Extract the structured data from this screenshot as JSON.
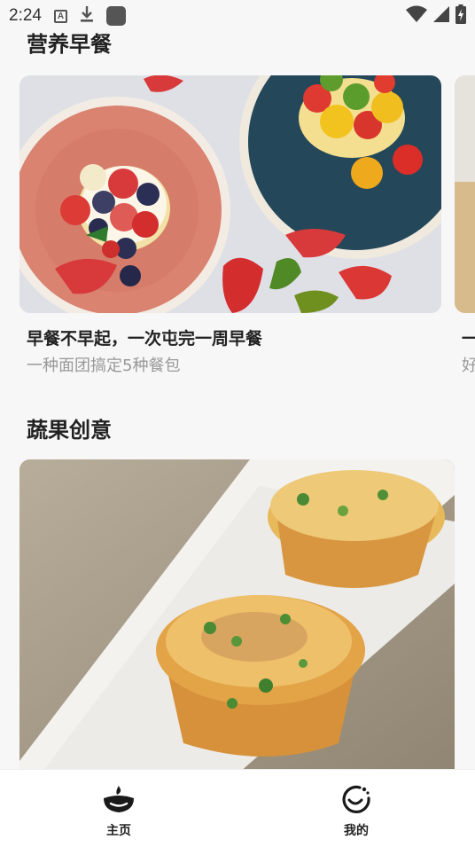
{
  "status_bar": {
    "time": "2:24",
    "icons": [
      "a-icon",
      "download-icon",
      "app-icon",
      "wifi-icon",
      "signal-icon",
      "battery-icon"
    ]
  },
  "sections": [
    {
      "title": "营养早餐",
      "cards": [
        {
          "title": "早餐不早起，一次屯完一周早餐",
          "subtitle": "一种面团搞定5种餐包"
        },
        {
          "title": "一",
          "subtitle": "好"
        }
      ]
    },
    {
      "title": "蔬果创意"
    }
  ],
  "tabbar": {
    "items": [
      {
        "label": "主页",
        "icon": "home-bowl-icon"
      },
      {
        "label": "我的",
        "icon": "smiley-moon-icon"
      }
    ]
  },
  "colors": {
    "background": "#f7f7f8",
    "tabbar": "#ffffff",
    "title": "#222222",
    "subtitle": "#999999"
  }
}
